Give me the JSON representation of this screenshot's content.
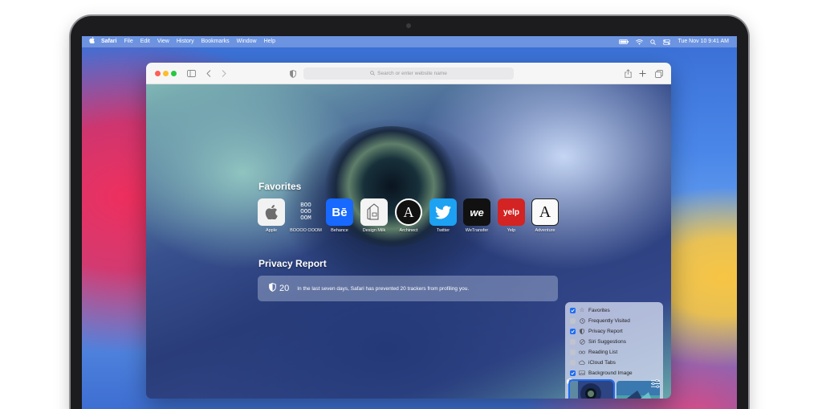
{
  "menubar": {
    "apple_icon": "apple-logo-icon",
    "items": [
      "Safari",
      "File",
      "Edit",
      "View",
      "History",
      "Bookmarks",
      "Window",
      "Help"
    ],
    "datetime": "Tue Nov 10  9:41 AM"
  },
  "toolbar": {
    "address_placeholder": "Search or enter website name"
  },
  "favorites": {
    "title": "Favorites",
    "items": [
      {
        "label": "Apple",
        "icon": "apple-icon"
      },
      {
        "label": "BOOOO OOOM",
        "icon": "boooooom-icon",
        "text": "BOO\nOOO\nOOM"
      },
      {
        "label": "Behance",
        "icon": "behance-icon",
        "text": "Bē"
      },
      {
        "label": "Design Milk",
        "icon": "design-milk-icon"
      },
      {
        "label": "Archinect",
        "icon": "archinect-icon",
        "text": "A"
      },
      {
        "label": "Twitter",
        "icon": "twitter-icon"
      },
      {
        "label": "WeTransfer",
        "icon": "wetransfer-icon",
        "text": "we"
      },
      {
        "label": "Yelp",
        "icon": "yelp-icon",
        "text": "yelp"
      },
      {
        "label": "Adventure",
        "icon": "adventure-icon",
        "text": "A"
      }
    ]
  },
  "privacy": {
    "title": "Privacy Report",
    "count": "20",
    "message": "In the last seven days, Safari has prevented 20 trackers from profiling you."
  },
  "customize": {
    "options": [
      {
        "label": "Favorites",
        "checked": true
      },
      {
        "label": "Frequently Visited",
        "checked": false
      },
      {
        "label": "Privacy Report",
        "checked": true
      },
      {
        "label": "Siri Suggestions",
        "checked": false
      },
      {
        "label": "Reading List",
        "checked": false
      },
      {
        "label": "iCloud Tabs",
        "checked": false
      },
      {
        "label": "Background Image",
        "checked": true
      }
    ]
  },
  "colors": {
    "accent": "#1e6cf2",
    "close": "#fe5f57",
    "minimize": "#febc2e",
    "zoom": "#28c840",
    "behance": "#1769ff",
    "twitter": "#1da1f2",
    "yelp": "#d32323"
  }
}
